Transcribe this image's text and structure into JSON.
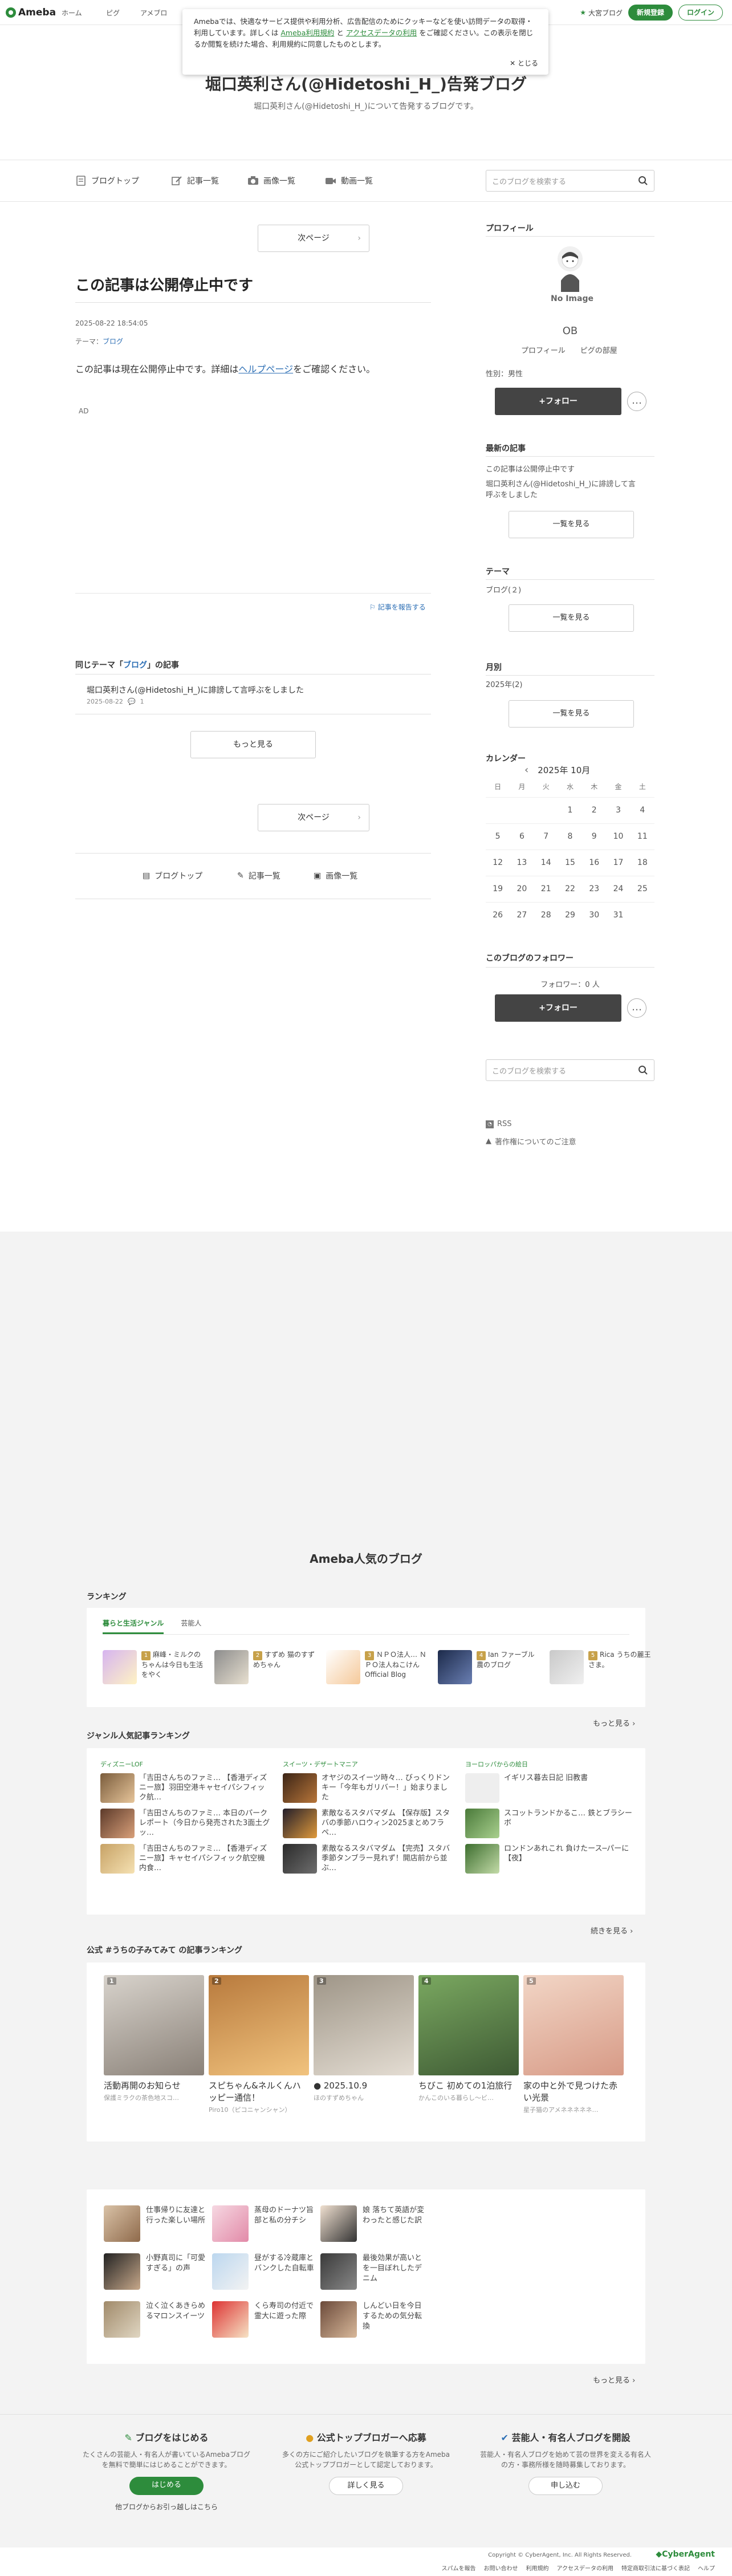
{
  "topbar": {
    "logo": "Ameba",
    "nav": [
      "ホーム",
      "ピグ",
      "アメブロ"
    ],
    "mypage": "大宮ブログ",
    "signup": "新規登録",
    "login": "ログイン"
  },
  "cookie": {
    "text1": "Amebaでは、快適なサービス提供や利用分析、広告配信のためにクッキーなどを使い訪問データの取得・利用しています。詳しくは ",
    "link1": "Ameba利用規約",
    "text2": " と ",
    "link2": "アクセスデータの利用",
    "text3": " をご確認ください。この表示を閉じるか閲覧を続けた場合、利用規約に同意したものとします。",
    "close": "とじる"
  },
  "blog": {
    "title": "堀口英利さん(@Hidetoshi_H_)告発ブログ",
    "description": "堀口英利さん(@Hidetoshi_H_)について告発するブログです。"
  },
  "blognav": {
    "top": "ブログトップ",
    "articles": "記事一覧",
    "images": "画像一覧",
    "videos": "動画一覧",
    "search_placeholder": "このブログを検索する"
  },
  "article": {
    "next": "次ページ",
    "title": "この記事は公開停止中です",
    "date": "2025-08-22 18:54:05",
    "theme_label": "テーマ：",
    "theme": "ブログ",
    "body_pre": "この記事は現在公開停止中です。詳細は",
    "body_link": "ヘルプページ",
    "body_post": "をご確認ください。",
    "ad": "AD",
    "report": "記事を報告する"
  },
  "same_theme": {
    "title_pre": "同じテーマ「",
    "title_link": "ブログ",
    "title_post": "」の記事",
    "item": "堀口英利さん(@Hidetoshi_H_)に誹謗して言呼ぶをしました",
    "date": "2025-08-22",
    "count": "1",
    "more": "もっと見る"
  },
  "bottomnav": {
    "next": "次ページ",
    "top": "ブログトップ",
    "articles": "記事一覧",
    "images": "画像一覧"
  },
  "sidebar": {
    "profile_h": "プロフィール",
    "no_image": "No Image",
    "name": "OB",
    "profile_link": "プロフィール",
    "room_link": "ピグの部屋",
    "gender": "性別：男性",
    "follow": "+フォロー",
    "latest_h": "最新の記事",
    "latest1": "この記事は公開停止中です",
    "latest2": "堀口英利さん(@Hidetoshi_H_)に誹謗して言呼ぶをしました",
    "list_btn": "一覧を見る",
    "theme_h": "テーマ",
    "theme_item": "ブログ(２)",
    "monthly_h": "月別",
    "monthly_item": "2025年(2)",
    "calendar_h": "カレンダー",
    "cal_month": "2025年 10月",
    "weekdays": [
      "日",
      "月",
      "火",
      "水",
      "木",
      "金",
      "土"
    ],
    "followers_h": "このブログのフォロワー",
    "followers": "フォロワー：0 人",
    "search_placeholder": "このブログを検索する",
    "rss": "RSS",
    "copyright": "著作権についてのご注意"
  },
  "calendar_rows": [
    [
      "",
      "",
      "",
      "1",
      "2",
      "3",
      "4"
    ],
    [
      "5",
      "6",
      "7",
      "8",
      "9",
      "10",
      "11"
    ],
    [
      "12",
      "13",
      "14",
      "15",
      "16",
      "17",
      "18"
    ],
    [
      "19",
      "20",
      "21",
      "22",
      "23",
      "24",
      "25"
    ],
    [
      "26",
      "27",
      "28",
      "29",
      "30",
      "31",
      ""
    ]
  ],
  "popular": {
    "title": "Ameba人気のブログ",
    "ranking_h": "ランキング",
    "tab1": "暮らと生活ジャンル",
    "tab2": "芸能人",
    "ranking": [
      {
        "rank": "1",
        "name": "麻峰・ミルクのちゃんは今日も生活をやく"
      },
      {
        "rank": "2",
        "name": "すずめ 猫のすずめちゃん"
      },
      {
        "rank": "3",
        "name": "ＮＰＯ法人… ＮＰＯ法人ねこけん Official Blog"
      },
      {
        "rank": "4",
        "name": "Ian ファーブル農のブログ"
      },
      {
        "rank": "5",
        "name": "Rica うちの麗王さま。"
      }
    ],
    "more": "もっと見る",
    "genre_h": "ジャンル人気記事ランキング",
    "genres": [
      {
        "label": "ディズニーLOF",
        "items": [
          "「吉田さんちのファミ… 【香港ディズニー旅】羽田空港キャセイパシフィック航…",
          "「吉田さんちのファミ… 本日のパークレポート（今日から発売された3面土グッ…",
          "「吉田さんちのファミ… 【香港ディズニー旅】キャセイパシフィック航空機内食…"
        ]
      },
      {
        "label": "スイーツ・デザートマニア",
        "items": [
          "オヤジのスイーツ時々… びっくりドンキー「今年もガリバー！」始まりました",
          "素敵なるスタバマダム 【保存版】スタバの季節ハロウィン2025まとめフラペ…",
          "素敵なるスタバマダム 【完売】スタバ季節タンブラー見れず！開店前から並ぶ…"
        ]
      },
      {
        "label": "ヨーロッパからの絵日",
        "items": [
          "イギリス暮去日記 旧教書",
          "スコットランドかるこ… 鉄とブラシーボ",
          "ロンドンあれこれ 負けたース─パーに【夜】"
        ]
      }
    ],
    "continue": "続きを見る",
    "kids_h": "公式 #うちの子みてみて の記事ランキング",
    "kids": [
      {
        "rank": "1",
        "title": "活動再開のお知らせ",
        "sub": "保護ミラクの茶色地スコ…"
      },
      {
        "rank": "2",
        "title": "スピちゃん&ネルくんハッピー通信！",
        "sub": "Piro10（ピコニャンシャン）"
      },
      {
        "rank": "3",
        "title": "● 2025.10.9",
        "sub": "ほのすずめちゃん"
      },
      {
        "rank": "4",
        "title": "ちびこ 初めての1泊旅行",
        "sub": "かんこのいる暮らし～ビ…"
      },
      {
        "rank": "5",
        "title": "家の中と外で見つけた赤い光景",
        "sub": "星子猫のアメネネネネネ…"
      }
    ],
    "top_items": [
      "仕事帰りに友達と行った楽しい場所",
      "蒸母のドーナツ旨部と私の分チシ",
      "娘 落ちて英語が変わったと感じた訳",
      "小野真司に「可愛すぎる」の声",
      "昼がする冷蔵庫とバンクした自転車",
      "最後効果が高いとを一目ぼれしたデニム",
      "泣く泣くあきらめるマロンスイーツ",
      "くら寿司の付近で霊大に遊った際",
      "しんどい日を今日するための気分転換"
    ],
    "more2": "もっと見る"
  },
  "cta": [
    {
      "h": "ブログをはじめる",
      "d": "たくさんの芸能人・有名人が書いているAmebaブログを無料で簡単にはじめることができます。",
      "btn": "はじめる",
      "sub": "他ブログからお引っ越しはこちら"
    },
    {
      "h": "公式トップブロガーへ応募",
      "d": "多くの方にご紹介したいブログを執筆する方をAmeba公式トップブロガーとして認定しております。",
      "btn": "詳しく見る"
    },
    {
      "h": "芸能人・有名人ブログを開設",
      "d": "芸能人・有名人ブログを始めて芸の世界を変える有名人の方・事務所様を随時募集しております。",
      "btn": "申し込む"
    }
  ],
  "footer": {
    "copyright": "Copyright © CyberAgent, Inc. All Rights Reserved.",
    "brand": "CyberAgent",
    "links": [
      "スパムを報告",
      "お問い合わせ",
      "利用規約",
      "アクセスデータの利用",
      "特定商取引法に基づく表記",
      "ヘルプ"
    ]
  },
  "colors": {
    "accent": "#2d8c3c",
    "link": "#2d6fb5",
    "gray_bg": "#f3f3f3"
  }
}
